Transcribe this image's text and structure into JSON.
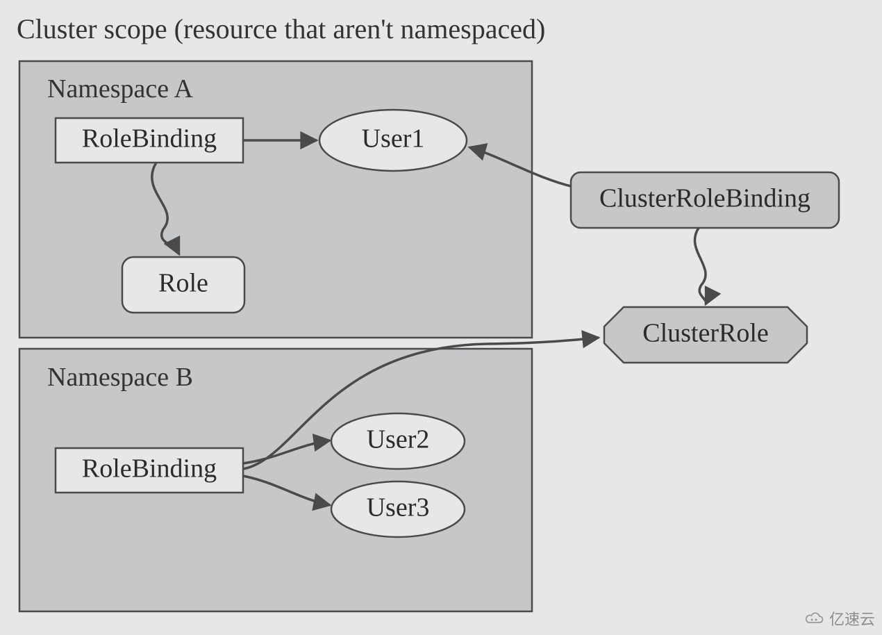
{
  "title": "Cluster scope (resource that aren't namespaced)",
  "groups": {
    "namespaceA": "Namespace A",
    "namespaceB": "Namespace B"
  },
  "nodes": {
    "roleBindingA": "RoleBinding",
    "roleBindingB": "RoleBinding",
    "role": "Role",
    "user1": "User1",
    "user2": "User2",
    "user3": "User3",
    "clusterRoleBinding": "ClusterRoleBinding",
    "clusterRole": "ClusterRole"
  },
  "watermark": "亿速云",
  "edges": [
    {
      "from": "roleBindingA",
      "to": "user1",
      "style": "straight"
    },
    {
      "from": "roleBindingA",
      "to": "role",
      "style": "wavy"
    },
    {
      "from": "clusterRoleBinding",
      "to": "user1",
      "style": "curve"
    },
    {
      "from": "clusterRoleBinding",
      "to": "clusterRole",
      "style": "wavy"
    },
    {
      "from": "roleBindingB",
      "to": "user2",
      "style": "curve"
    },
    {
      "from": "roleBindingB",
      "to": "user3",
      "style": "curve"
    },
    {
      "from": "roleBindingB",
      "to": "clusterRole",
      "style": "curve"
    }
  ],
  "colors": {
    "background": "#E6E7E8",
    "groupFill": "#C6C7C8",
    "lightFill": "#E6E7E8",
    "medFill": "#C6C7C8",
    "stroke": "#4a4a4a"
  }
}
